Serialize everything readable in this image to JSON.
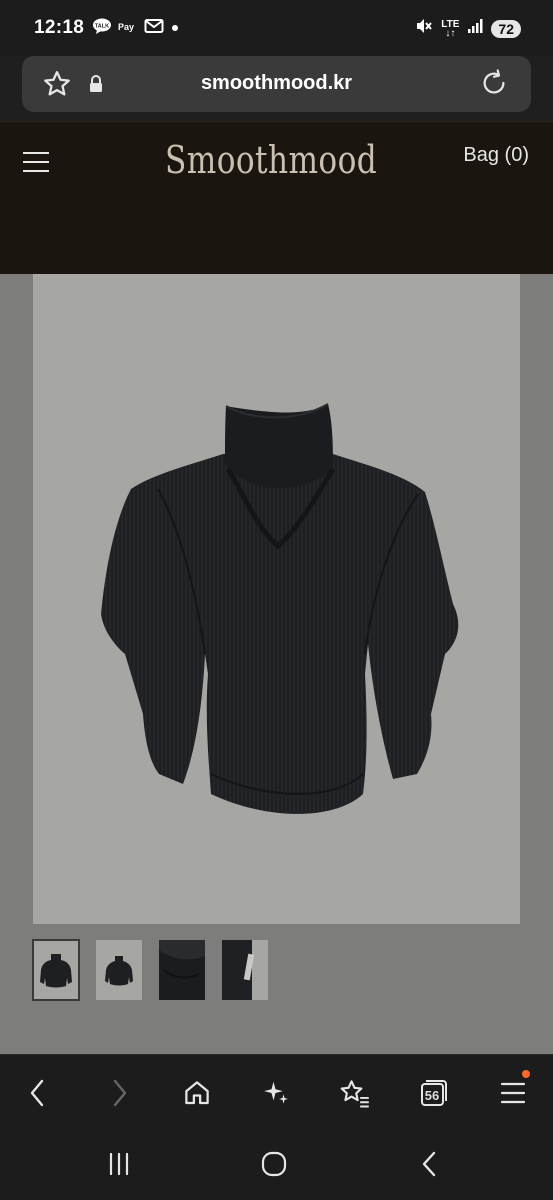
{
  "status_bar": {
    "time": "12:18",
    "network": "LTE",
    "battery": "72",
    "notifications": [
      "talk-icon",
      "naver-icon",
      "mail-icon",
      "dot-icon"
    ]
  },
  "browser": {
    "url": "smoothmood.kr",
    "tabs_count": "56",
    "accent_dot_color": "#ff6a2b"
  },
  "site": {
    "logo": "Smoothmood",
    "bag_label": "Bag (0)",
    "header_bg": "#1a150f"
  },
  "product": {
    "image_bg": "#a6a6a3",
    "thumbnails": [
      "front-on-grey",
      "front-small-on-grey",
      "collar-detail-dark",
      "label-detail-dark"
    ],
    "selected_thumbnail": 0
  }
}
